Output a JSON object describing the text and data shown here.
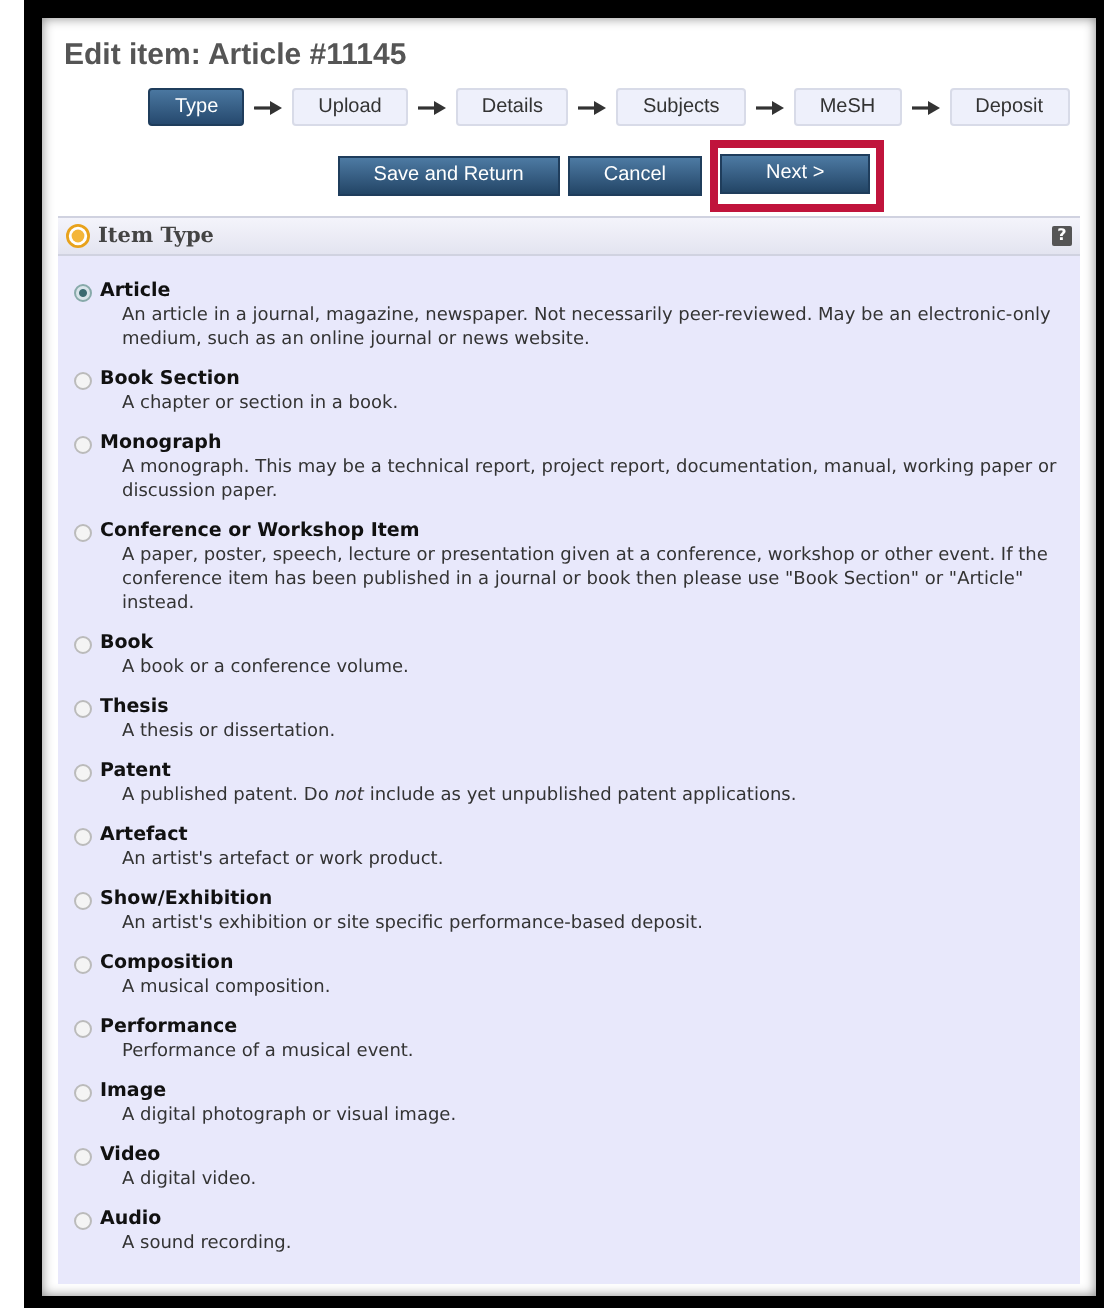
{
  "title": "Edit item: Article #11145",
  "steps": [
    {
      "label": "Type",
      "selected": true
    },
    {
      "label": "Upload",
      "selected": false
    },
    {
      "label": "Details",
      "selected": false
    },
    {
      "label": "Subjects",
      "selected": false
    },
    {
      "label": "MeSH",
      "selected": false
    },
    {
      "label": "Deposit",
      "selected": false
    }
  ],
  "buttons": [
    {
      "label": "Save and Return",
      "highlighted": false
    },
    {
      "label": "Cancel",
      "highlighted": false
    },
    {
      "label": "Next >",
      "highlighted": true
    }
  ],
  "section": {
    "title": "Item Type",
    "help": "?"
  },
  "item_types": [
    {
      "label": "Article",
      "selected": true,
      "description": "An article in a journal, magazine, newspaper. Not necessarily peer-reviewed. May be an electronic-only medium, such as an online journal or news website."
    },
    {
      "label": "Book Section",
      "selected": false,
      "description": "A chapter or section in a book."
    },
    {
      "label": "Monograph",
      "selected": false,
      "description": "A monograph. This may be a technical report, project report, documentation, manual, working paper or discussion paper."
    },
    {
      "label": "Conference or Workshop Item",
      "selected": false,
      "description": "A paper, poster, speech, lecture or presentation given at a conference, workshop or other event. If the conference item has been published in a journal or book then please use \"Book Section\" or \"Article\" instead."
    },
    {
      "label": "Book",
      "selected": false,
      "description": "A book or a conference volume."
    },
    {
      "label": "Thesis",
      "selected": false,
      "description": "A thesis or dissertation."
    },
    {
      "label": "Patent",
      "selected": false,
      "description": "A published patent. Do *not* include as yet unpublished patent applications."
    },
    {
      "label": "Artefact",
      "selected": false,
      "description": "An artist's artefact or work product."
    },
    {
      "label": "Show/Exhibition",
      "selected": false,
      "description": "An artist's exhibition or site specific performance-based deposit."
    },
    {
      "label": "Composition",
      "selected": false,
      "description": "A musical composition."
    },
    {
      "label": "Performance",
      "selected": false,
      "description": "Performance of a musical event."
    },
    {
      "label": "Image",
      "selected": false,
      "description": "A digital photograph or visual image."
    },
    {
      "label": "Video",
      "selected": false,
      "description": "A digital video."
    },
    {
      "label": "Audio",
      "selected": false,
      "description": "A sound recording."
    }
  ]
}
